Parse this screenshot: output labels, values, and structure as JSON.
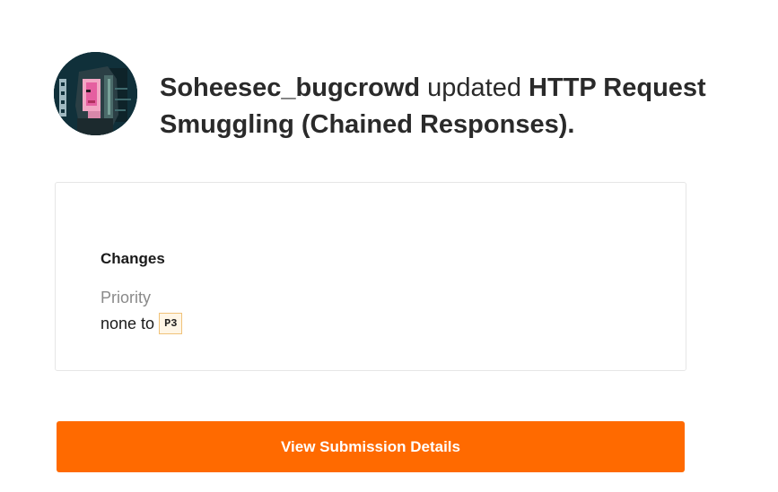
{
  "header": {
    "actor": "Soheesec_bugcrowd",
    "verb": "updated",
    "subject": "HTTP Request Smuggling (Chained Responses).",
    "avatar_icon": "pixel-art-avatar-icon"
  },
  "changes": {
    "title": "Changes",
    "field_label": "Priority",
    "from_text": "none to",
    "to_badge": "P3"
  },
  "cta": {
    "label": "View Submission Details",
    "color": "#ff6a00"
  }
}
